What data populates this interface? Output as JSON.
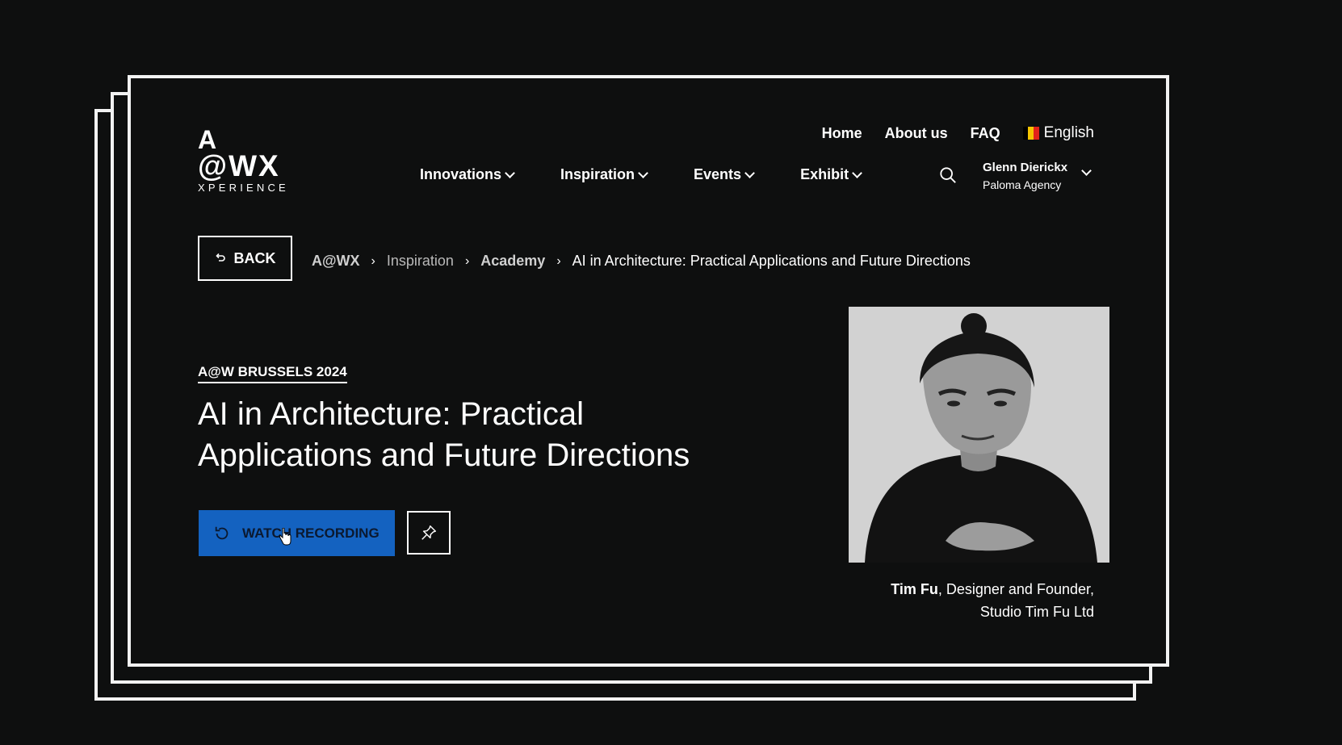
{
  "logo": {
    "line1": "A",
    "line2": "@WX",
    "line3": "XPERIENCE"
  },
  "top_nav": {
    "links": [
      "Home",
      "About us",
      "FAQ"
    ],
    "language": "English",
    "flag_colors": [
      "#000000",
      "#f5c400",
      "#e2231a"
    ]
  },
  "main_nav": [
    "Innovations",
    "Inspiration",
    "Events",
    "Exhibit"
  ],
  "user": {
    "name": "Glenn Dierickx",
    "org": "Paloma Agency"
  },
  "back_label": "BACK",
  "breadcrumb": [
    "A@WX",
    "Inspiration",
    "Academy",
    "AI in Architecture: Practical Applications and Future Directions"
  ],
  "event_label": "A@W BRUSSELS 2024",
  "title": "AI in Architecture: Practical Applications and Future Directions",
  "watch_label": "WATCH RECORDING",
  "speaker": {
    "name": "Tim Fu",
    "role": ", Designer and Founder,",
    "company": "Studio Tim Fu Ltd"
  },
  "colors": {
    "accent": "#1462c0",
    "background": "#0e0f0f",
    "frame": "#f2f2f2"
  },
  "icons": [
    "back-arrow-icon",
    "search-icon",
    "chevron-down-icon",
    "replay-icon",
    "pin-icon",
    "cursor-hand-icon"
  ]
}
